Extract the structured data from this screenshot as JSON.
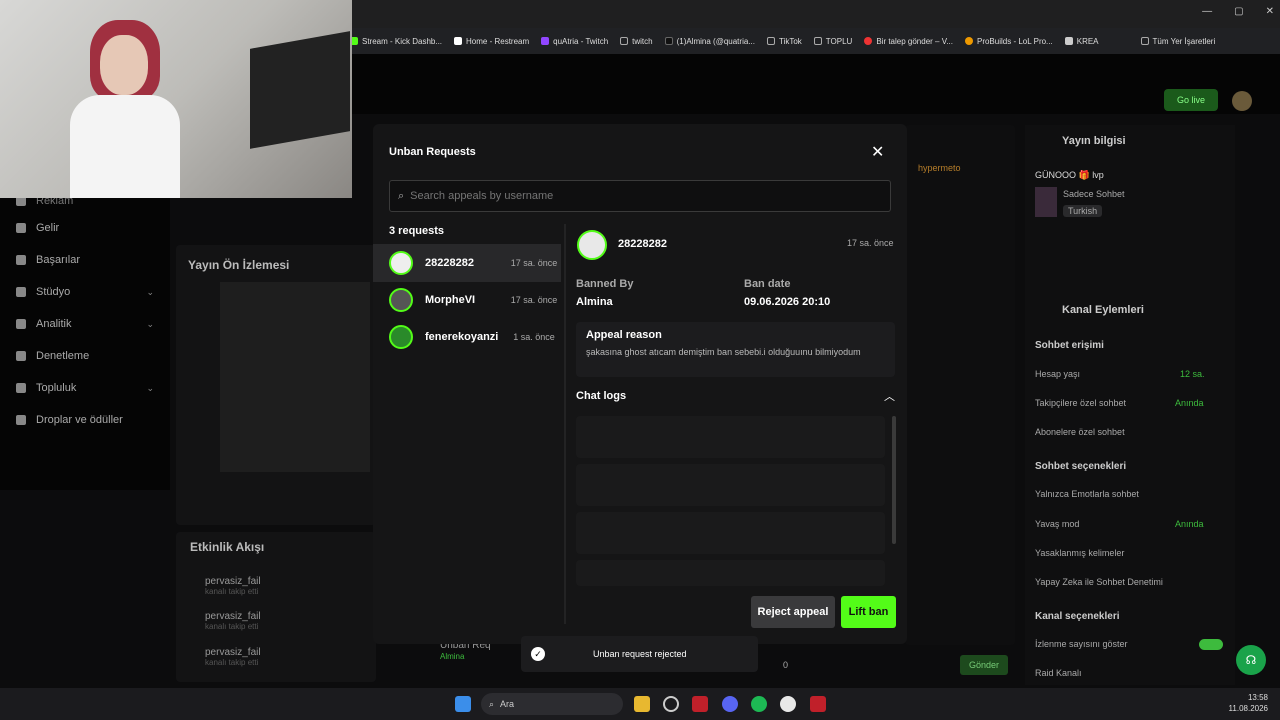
{
  "browser": {
    "bookmarks": [
      "Stream - Kick Dashb...",
      "Home - Restream",
      "quAtria - Twitch",
      "twitch",
      "(1)Almina (@quatria...",
      "TikTok",
      "TOPLU",
      "Bir talep gönder – V...",
      "ProBuilds - LoL Pro...",
      "KREA"
    ],
    "all_bookmarks": "Tüm Yer İşaretleri"
  },
  "header": {
    "go_live": "Go live"
  },
  "sidebar": {
    "items": [
      {
        "label": "Reklam"
      },
      {
        "label": "Gelir"
      },
      {
        "label": "Başarılar"
      },
      {
        "label": "Stüdyo"
      },
      {
        "label": "Analitik"
      },
      {
        "label": "Denetleme"
      },
      {
        "label": "Topluluk"
      },
      {
        "label": "Droplar ve ödüller"
      }
    ]
  },
  "background": {
    "preview_title": "Yayın Ön İzlemesi",
    "activity_title": "Etkinlik Akışı",
    "activity": [
      {
        "user": "pervasiz_fail",
        "action": "kanalı takip etti"
      },
      {
        "user": "pervasiz_fail",
        "action": "kanalı takip etti"
      },
      {
        "user": "pervasiz_fail",
        "action": "kanalı takip etti"
      }
    ],
    "bottom_req": "Unban Req",
    "bottom_req_user": "Almina",
    "send": "Gönder",
    "viewers": "0",
    "chat_user": "hypermeto"
  },
  "right_panel": {
    "stream_info_title": "Yayın bilgisi",
    "stream_title": "GÜNOOO 🎁 lvp",
    "category": "Sadece Sohbet",
    "tag": "Turkish",
    "channel_actions_title": "Kanal Eylemleri",
    "chat_access": "Sohbet erişimi",
    "account_age": "Hesap yaşı",
    "account_age_val": "12 sa.",
    "followers_only": "Takipçilere özel sohbet",
    "followers_only_val": "Anında",
    "subscribers_only": "Abonelere özel sohbet",
    "chat_options": "Sohbet seçenekleri",
    "emotes_only": "Yalnızca Emotlarla sohbet",
    "slow_mode": "Yavaş mod",
    "slow_mode_val": "Anında",
    "banned_words": "Yasaklanmış kelimeler",
    "ai_moderation": "Yapay Zeka ile Sohbet Denetimi",
    "channel_options": "Kanal seçenekleri",
    "show_viewers": "İzlenme sayısını göster",
    "raid": "Raid Kanalı"
  },
  "modal": {
    "title": "Unban Requests",
    "search_placeholder": "Search appeals by username",
    "count": "3 requests",
    "requests": [
      {
        "name": "28228282",
        "time": "17 sa. önce"
      },
      {
        "name": "MorpheVI",
        "time": "17 sa. önce"
      },
      {
        "name": "fenerekoyanzi",
        "time": "1 sa. önce"
      }
    ],
    "detail": {
      "name": "28228282",
      "time": "17 sa. önce",
      "banned_by_label": "Banned By",
      "banned_by": "Almina",
      "ban_date_label": "Ban date",
      "ban_date": "09.06.2026 20:10",
      "appeal_label": "Appeal reason",
      "appeal_text": "şakasına ghost atıcam demiştim ban sebebi.i olduğuuınu bilmiyodum",
      "chat_logs_label": "Chat logs"
    },
    "reject": "Reject appeal",
    "lift": "Lift ban"
  },
  "toast": {
    "text": "Unban request rejected"
  },
  "taskbar": {
    "search": "Ara",
    "time": "13:58",
    "date": "11.08.2026"
  },
  "colors": {
    "accent": "#53fc18",
    "modal_bg": "#151516"
  }
}
